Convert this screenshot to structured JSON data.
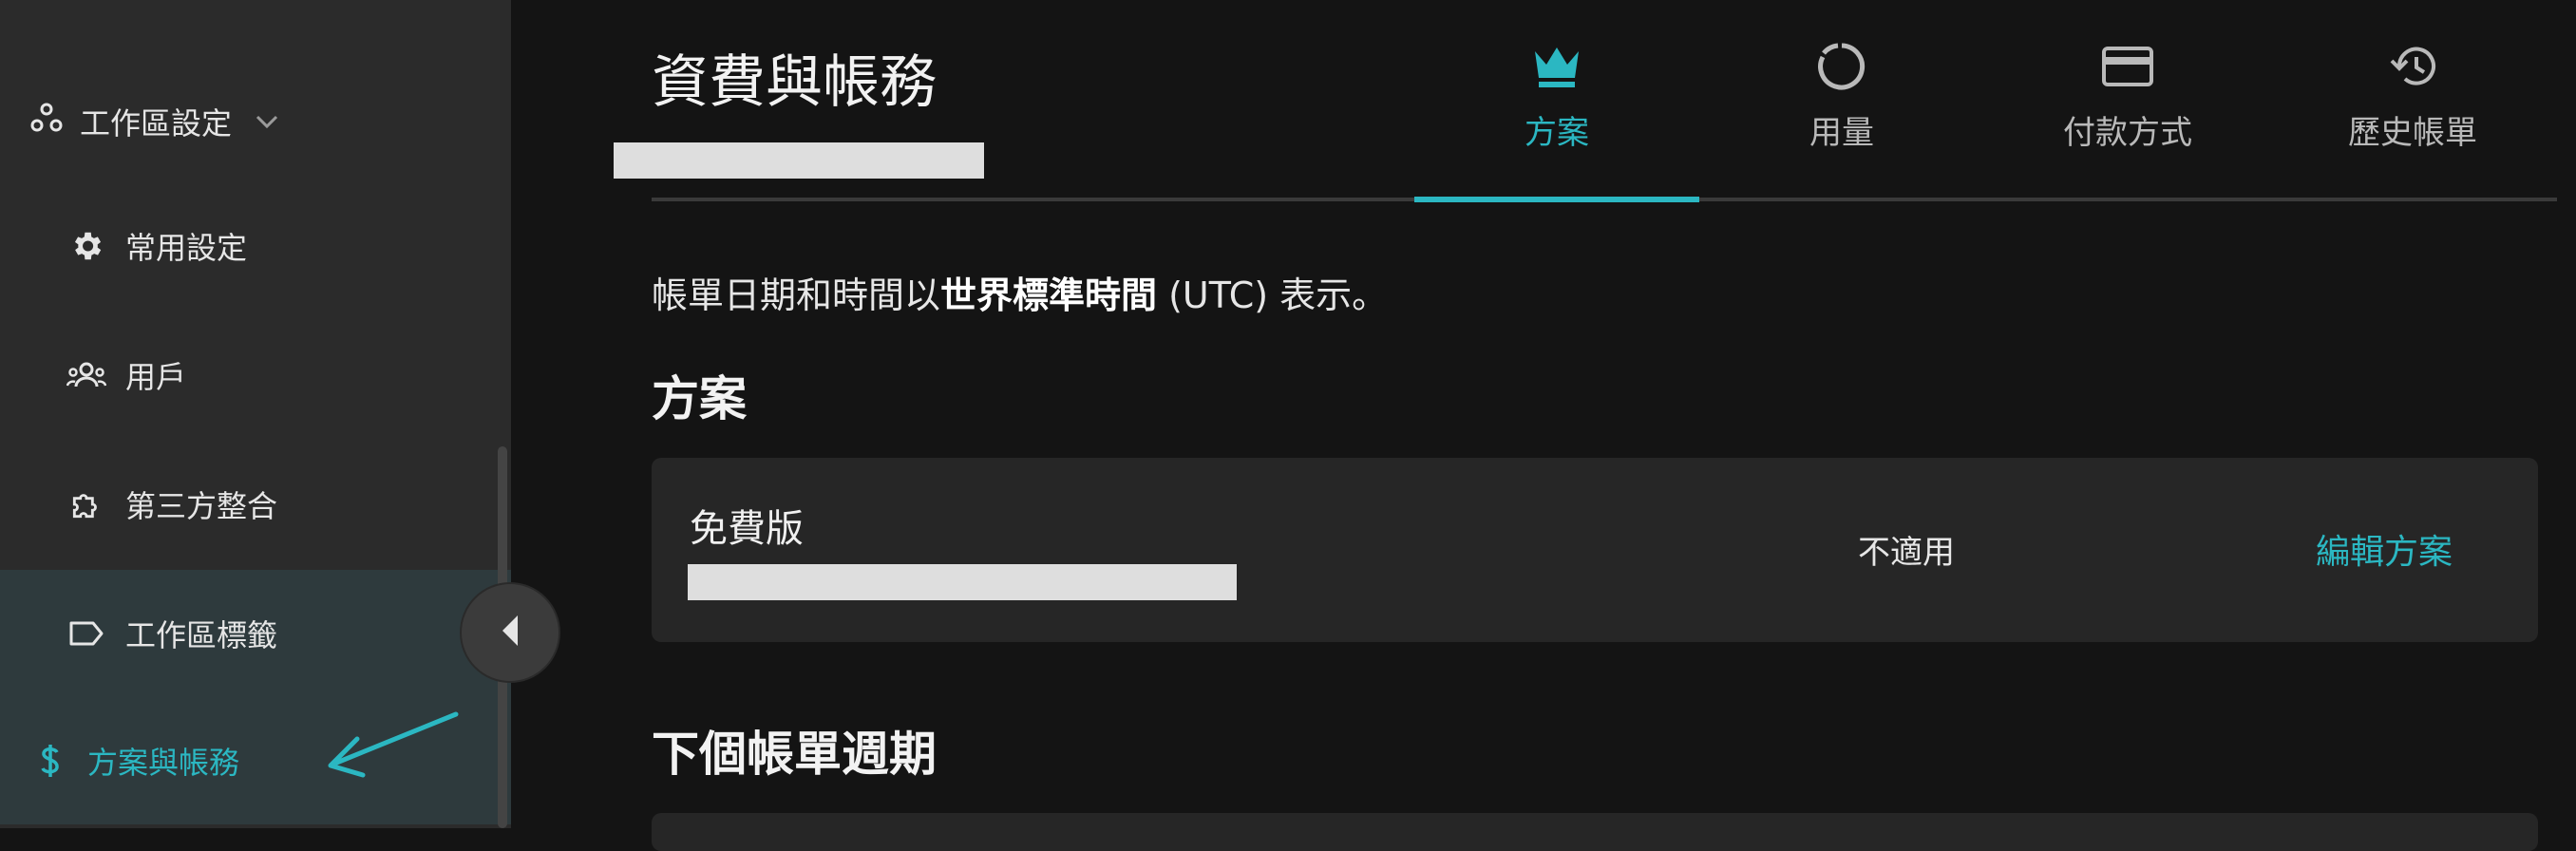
{
  "sidebar": {
    "workspace_settings_label": "工作區設定",
    "items": [
      {
        "label": "常用設定",
        "icon": "gear-icon"
      },
      {
        "label": "用戶",
        "icon": "users-icon"
      },
      {
        "label": "第三方整合",
        "icon": "puzzle-icon"
      },
      {
        "label": "工作區標籤",
        "icon": "tag-icon"
      },
      {
        "label": "方案與帳務",
        "icon": "dollar-icon"
      }
    ]
  },
  "header": {
    "title": "資費與帳務"
  },
  "tabs": [
    {
      "label": "方案",
      "icon": "crown-icon",
      "active": true
    },
    {
      "label": "用量",
      "icon": "usage-circle-icon",
      "active": false
    },
    {
      "label": "付款方式",
      "icon": "credit-card-icon",
      "active": false
    },
    {
      "label": "歷史帳單",
      "icon": "history-icon",
      "active": false
    }
  ],
  "notice": {
    "prefix": "帳單日期和時間以",
    "bold": "世界標準時間",
    "suffix": " (UTC) 表示。"
  },
  "plan_section": {
    "title": "方案",
    "plan_name": "免費版",
    "price": "不適用",
    "edit_label": "編輯方案"
  },
  "next_cycle_section": {
    "title": "下個帳單週期"
  },
  "colors": {
    "accent": "#2bb7c2",
    "background": "#141414",
    "sidebar": "#2b2b2b",
    "card": "#262626"
  }
}
